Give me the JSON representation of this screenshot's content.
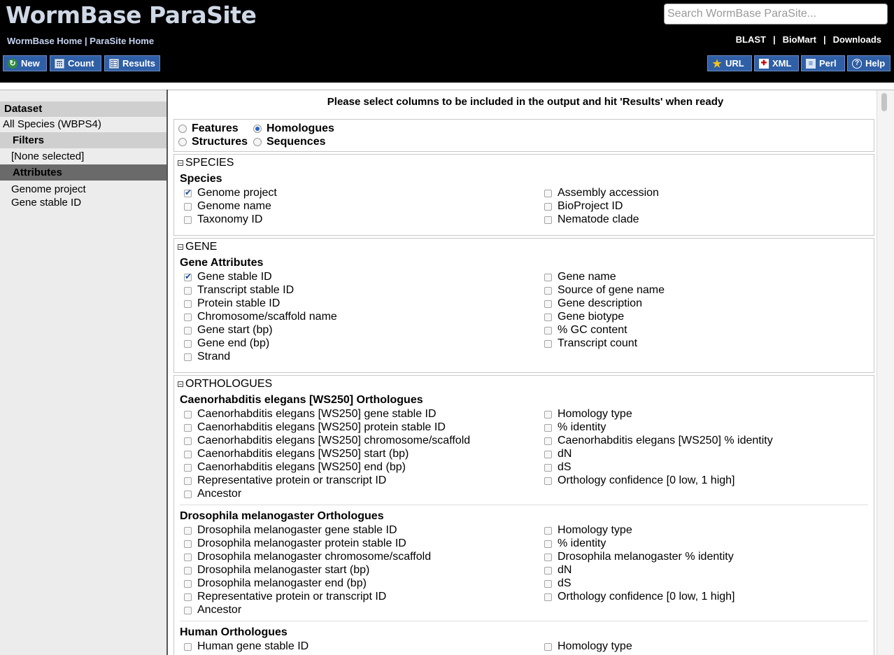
{
  "header": {
    "logo": "WormBase ParaSite",
    "links": [
      "WormBase Home",
      "ParaSite Home"
    ],
    "search_placeholder": "Search WormBase ParaSite...",
    "right_links": [
      "BLAST",
      "BioMart",
      "Downloads"
    ],
    "buttons_left": [
      "New",
      "Count",
      "Results"
    ],
    "buttons_right": [
      "URL",
      "XML",
      "Perl",
      "Help"
    ]
  },
  "sidebar": {
    "dataset_label": "Dataset",
    "dataset_value": "All Species (WBPS4)",
    "filters_label": "Filters",
    "filters_value": "[None selected]",
    "attributes_label": "Attributes",
    "attribute_items": [
      "Genome project",
      "Gene stable ID"
    ]
  },
  "main": {
    "instruction": "Please select columns to be included in the output and hit 'Results' when ready",
    "page_types": [
      {
        "label": "Features",
        "selected": false
      },
      {
        "label": "Homologues",
        "selected": true
      },
      {
        "label": "Structures",
        "selected": false
      },
      {
        "label": "Sequences",
        "selected": false
      }
    ],
    "sections": {
      "species": {
        "title": "SPECIES",
        "group": "Species",
        "left": [
          {
            "label": "Genome project",
            "checked": true
          },
          {
            "label": "Genome name",
            "checked": false
          },
          {
            "label": "Taxonomy ID",
            "checked": false
          }
        ],
        "right": [
          {
            "label": "Assembly accession",
            "checked": false
          },
          {
            "label": "BioProject ID",
            "checked": false
          },
          {
            "label": "Nematode clade",
            "checked": false
          }
        ]
      },
      "gene": {
        "title": "GENE",
        "group": "Gene Attributes",
        "left": [
          {
            "label": "Gene stable ID",
            "checked": true
          },
          {
            "label": "Transcript stable ID",
            "checked": false
          },
          {
            "label": "Protein stable ID",
            "checked": false
          },
          {
            "label": "Chromosome/scaffold name",
            "checked": false
          },
          {
            "label": "Gene start (bp)",
            "checked": false
          },
          {
            "label": "Gene end (bp)",
            "checked": false
          },
          {
            "label": "Strand",
            "checked": false
          }
        ],
        "right": [
          {
            "label": "Gene name",
            "checked": false
          },
          {
            "label": "Source of gene name",
            "checked": false
          },
          {
            "label": "Gene description",
            "checked": false
          },
          {
            "label": "Gene biotype",
            "checked": false
          },
          {
            "label": "% GC content",
            "checked": false
          },
          {
            "label": "Transcript count",
            "checked": false
          }
        ]
      },
      "orthologues": {
        "title": "ORTHOLOGUES",
        "groups": [
          {
            "title": "Caenorhabditis elegans [WS250] Orthologues",
            "left": [
              "Caenorhabditis elegans [WS250] gene stable ID",
              "Caenorhabditis elegans [WS250] protein stable ID",
              "Caenorhabditis elegans [WS250] chromosome/scaffold",
              "Caenorhabditis elegans [WS250] start (bp)",
              "Caenorhabditis elegans [WS250] end (bp)",
              "Representative protein or transcript ID",
              "Ancestor"
            ],
            "right": [
              "Homology type",
              "% identity",
              "Caenorhabditis elegans [WS250] % identity",
              "dN",
              "dS",
              "Orthology confidence [0 low, 1 high]"
            ]
          },
          {
            "title": "Drosophila melanogaster Orthologues",
            "left": [
              "Drosophila melanogaster gene stable ID",
              "Drosophila melanogaster protein stable ID",
              "Drosophila melanogaster chromosome/scaffold",
              "Drosophila melanogaster start (bp)",
              "Drosophila melanogaster end (bp)",
              "Representative protein or transcript ID",
              "Ancestor"
            ],
            "right": [
              "Homology type",
              "% identity",
              "Drosophila melanogaster % identity",
              "dN",
              "dS",
              "Orthology confidence [0 low, 1 high]"
            ]
          },
          {
            "title": "Human Orthologues",
            "left": [
              "Human gene stable ID"
            ],
            "right": [
              "Homology type"
            ]
          }
        ]
      }
    }
  }
}
